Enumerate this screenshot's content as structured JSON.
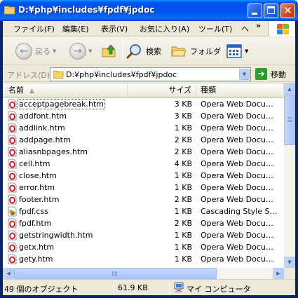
{
  "window": {
    "title": "D:¥php¥includes¥fpdf¥jpdoc"
  },
  "menubar": {
    "items": [
      {
        "label": "ファイル(F)"
      },
      {
        "label": "編集(E)"
      },
      {
        "label": "表示(V)"
      },
      {
        "label": "お気に入り(A)"
      },
      {
        "label": "ツール(T)"
      },
      {
        "label": "ヘ"
      }
    ],
    "overflow_icon": "double-chevron-right-icon"
  },
  "toolbar": {
    "back_label": "戻る",
    "forward_icon": "forward-arrow-icon",
    "up_icon": "folder-up-icon",
    "search_label": "検索",
    "folders_label": "フォルダ",
    "views_icon": "views-icon"
  },
  "addressbar": {
    "label": "アドレス(D)",
    "value": "D:¥php¥includes¥fpdf¥jpdoc",
    "go_label": "移動"
  },
  "listview": {
    "columns": {
      "name": "名前",
      "size": "サイズ",
      "type": "種類"
    },
    "files": [
      {
        "name": "acceptpagebreak.htm",
        "size": "3 KB",
        "type": "Opera Web Docume...",
        "icon": "opera-doc-icon"
      },
      {
        "name": "addfont.htm",
        "size": "3 KB",
        "type": "Opera Web Docume...",
        "icon": "opera-doc-icon"
      },
      {
        "name": "addlink.htm",
        "size": "1 KB",
        "type": "Opera Web Docume...",
        "icon": "opera-doc-icon"
      },
      {
        "name": "addpage.htm",
        "size": "2 KB",
        "type": "Opera Web Docume...",
        "icon": "opera-doc-icon"
      },
      {
        "name": "aliasnbpages.htm",
        "size": "2 KB",
        "type": "Opera Web Docume...",
        "icon": "opera-doc-icon"
      },
      {
        "name": "cell.htm",
        "size": "4 KB",
        "type": "Opera Web Docume...",
        "icon": "opera-doc-icon"
      },
      {
        "name": "close.htm",
        "size": "1 KB",
        "type": "Opera Web Docume...",
        "icon": "opera-doc-icon"
      },
      {
        "name": "error.htm",
        "size": "1 KB",
        "type": "Opera Web Docume...",
        "icon": "opera-doc-icon"
      },
      {
        "name": "footer.htm",
        "size": "2 KB",
        "type": "Opera Web Docume...",
        "icon": "opera-doc-icon"
      },
      {
        "name": "fpdf.css",
        "size": "1 KB",
        "type": "Cascading Style Sh...",
        "icon": "css-file-icon"
      },
      {
        "name": "fpdf.htm",
        "size": "2 KB",
        "type": "Opera Web Docume...",
        "icon": "opera-doc-icon"
      },
      {
        "name": "getstringwidth.htm",
        "size": "1 KB",
        "type": "Opera Web Docume...",
        "icon": "opera-doc-icon"
      },
      {
        "name": "getx.htm",
        "size": "1 KB",
        "type": "Opera Web Docume...",
        "icon": "opera-doc-icon"
      },
      {
        "name": "gety.htm",
        "size": "1 KB",
        "type": "Opera Web Docume...",
        "icon": "opera-doc-icon"
      }
    ]
  },
  "statusbar": {
    "objects": "49 個のオブジェクト",
    "total_size": "61.9 KB",
    "location": "マイ コンピュータ"
  },
  "colors": {
    "title_blue": "#0053ee",
    "client_bg": "#ece9d8",
    "close_red": "#d4491f",
    "go_green": "#2d9a34"
  }
}
